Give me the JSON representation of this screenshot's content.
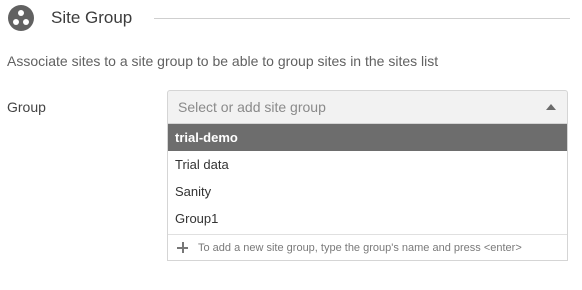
{
  "section": {
    "title": "Site Group",
    "icon": "group-circle-icon"
  },
  "description": "Associate sites to a site group to be able to group sites in the sites list",
  "group_field": {
    "label": "Group",
    "placeholder": "Select or add site group",
    "caret_icon": "caret-up-icon"
  },
  "dropdown": {
    "options": [
      {
        "label": "trial-demo",
        "highlighted": true
      },
      {
        "label": "Trial data",
        "highlighted": false
      },
      {
        "label": "Sanity",
        "highlighted": false
      },
      {
        "label": "Group1",
        "highlighted": false
      }
    ],
    "hint_icon": "plus-icon",
    "hint": "To add a new site group, type the group's name and press <enter>"
  },
  "colors": {
    "highlight_bg": "#6d6d6d",
    "field_bg": "#f2f2f2",
    "icon_bg": "#616161"
  }
}
